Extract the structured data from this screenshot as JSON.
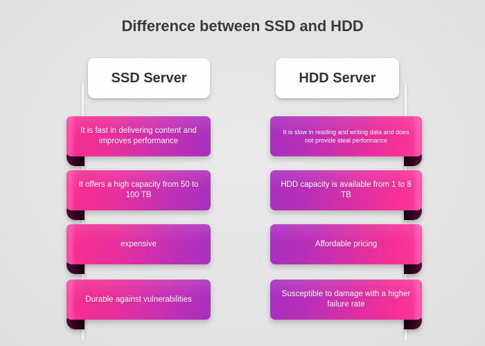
{
  "title": "Difference between SSD and HDD",
  "background_color": "#e6e6e6",
  "columns": [
    {
      "id": "ssd",
      "header": "SSD Server",
      "accent_start": "#f8349a",
      "accent_end": "#a730c0",
      "fold_color": "#3c0526",
      "rows": [
        {
          "text": "It is fast in delivering content and improves performance",
          "size": "normal"
        },
        {
          "text": "It offers a high capacity from 50 to 100 TB",
          "size": "normal"
        },
        {
          "text": "expensive",
          "size": "normal"
        },
        {
          "text": "Durable against vulnerabilities",
          "size": "normal"
        }
      ]
    },
    {
      "id": "hdd",
      "header": "HDD Server",
      "accent_start": "#a730c0",
      "accent_end": "#fb3b9e",
      "fold_color": "#3c0526",
      "rows": [
        {
          "text": "It is slow in reading and writing data and does not provide ideal performance",
          "size": "small"
        },
        {
          "text": "HDD capacity is available from 1 to 8 TB",
          "size": "normal"
        },
        {
          "text": "Affordable pricing",
          "size": "normal"
        },
        {
          "text": "Susceptible to damage with a higher failure rate",
          "size": "normal"
        }
      ]
    }
  ]
}
